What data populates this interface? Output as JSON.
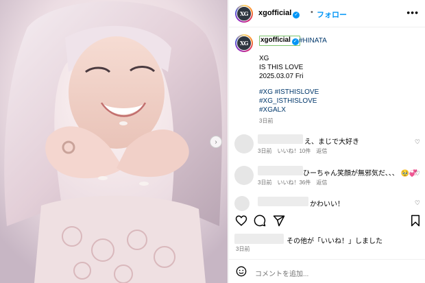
{
  "header": {
    "username": "xgofficial",
    "avatar_text": "XG",
    "separator": "•",
    "follow_label": "フォロー",
    "more_label": "•••"
  },
  "caption": {
    "username": "xgofficial",
    "tag": "#HINATA",
    "lines": [
      "XG",
      "IS THIS LOVE",
      "2025.03.07 Fri"
    ],
    "hashtags": [
      "#XG #ISTHISLOVE",
      "#XG_ISTHISLOVE",
      "#XGALX"
    ],
    "time": "3日前"
  },
  "comments": [
    {
      "text": "え、まじで大好き",
      "time": "3日前",
      "likes": "いいね！10件",
      "reply": "返信"
    },
    {
      "text": "ひーちゃん笑顔が無邪気だ、、、 🥹💞",
      "time": "3日前",
      "likes": "いいね！36件",
      "reply": "返信"
    },
    {
      "text": "かわいい！"
    }
  ],
  "likes_text": "その他が「いいね！」しました",
  "post_date": "3日前",
  "add_comment_placeholder": "コメントを追加...",
  "icons": {
    "carousel_next": "chevron-right-icon",
    "heart": "heart-icon",
    "comment": "comment-icon",
    "share": "share-icon",
    "save": "bookmark-icon",
    "emoji": "emoji-icon",
    "verified": "verified-badge-icon"
  },
  "colors": {
    "accent": "#0095f6",
    "link": "#00376b",
    "muted": "#737373"
  }
}
